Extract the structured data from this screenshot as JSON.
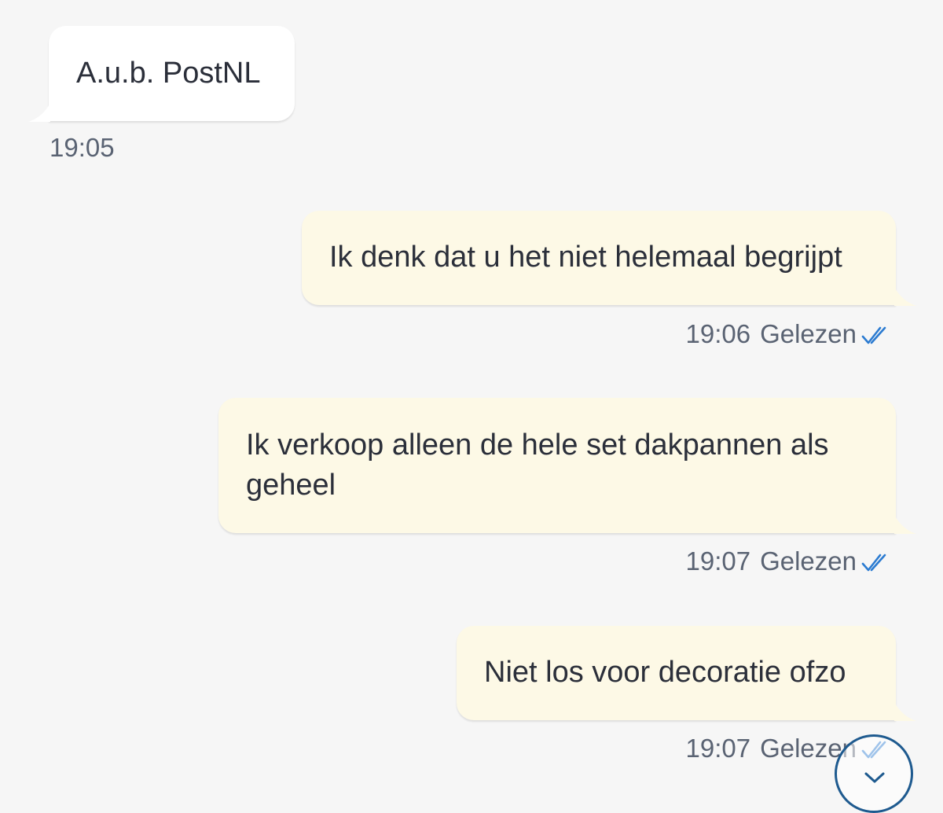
{
  "messages": [
    {
      "direction": "incoming",
      "text": "A.u.b. PostNL",
      "time": "19:05"
    },
    {
      "direction": "outgoing",
      "text": "Ik denk dat u het niet helemaal begrijpt",
      "time": "19:06",
      "status": "Gelezen"
    },
    {
      "direction": "outgoing",
      "text": "Ik verkoop alleen de hele set dakpannen als geheel",
      "time": "19:07",
      "status": "Gelezen"
    },
    {
      "direction": "outgoing",
      "text": "Niet los voor decoratie ofzo",
      "time": "19:07",
      "status": "Gelezen"
    }
  ],
  "icons": {
    "read_receipt": "double-check-icon",
    "scroll_down": "chevron-down-icon"
  },
  "colors": {
    "background": "#f6f6f6",
    "incoming_bubble": "#ffffff",
    "outgoing_bubble": "#fdf9e6",
    "read_tick": "#2b7bd1",
    "scroll_button_border": "#1e5a8f"
  }
}
